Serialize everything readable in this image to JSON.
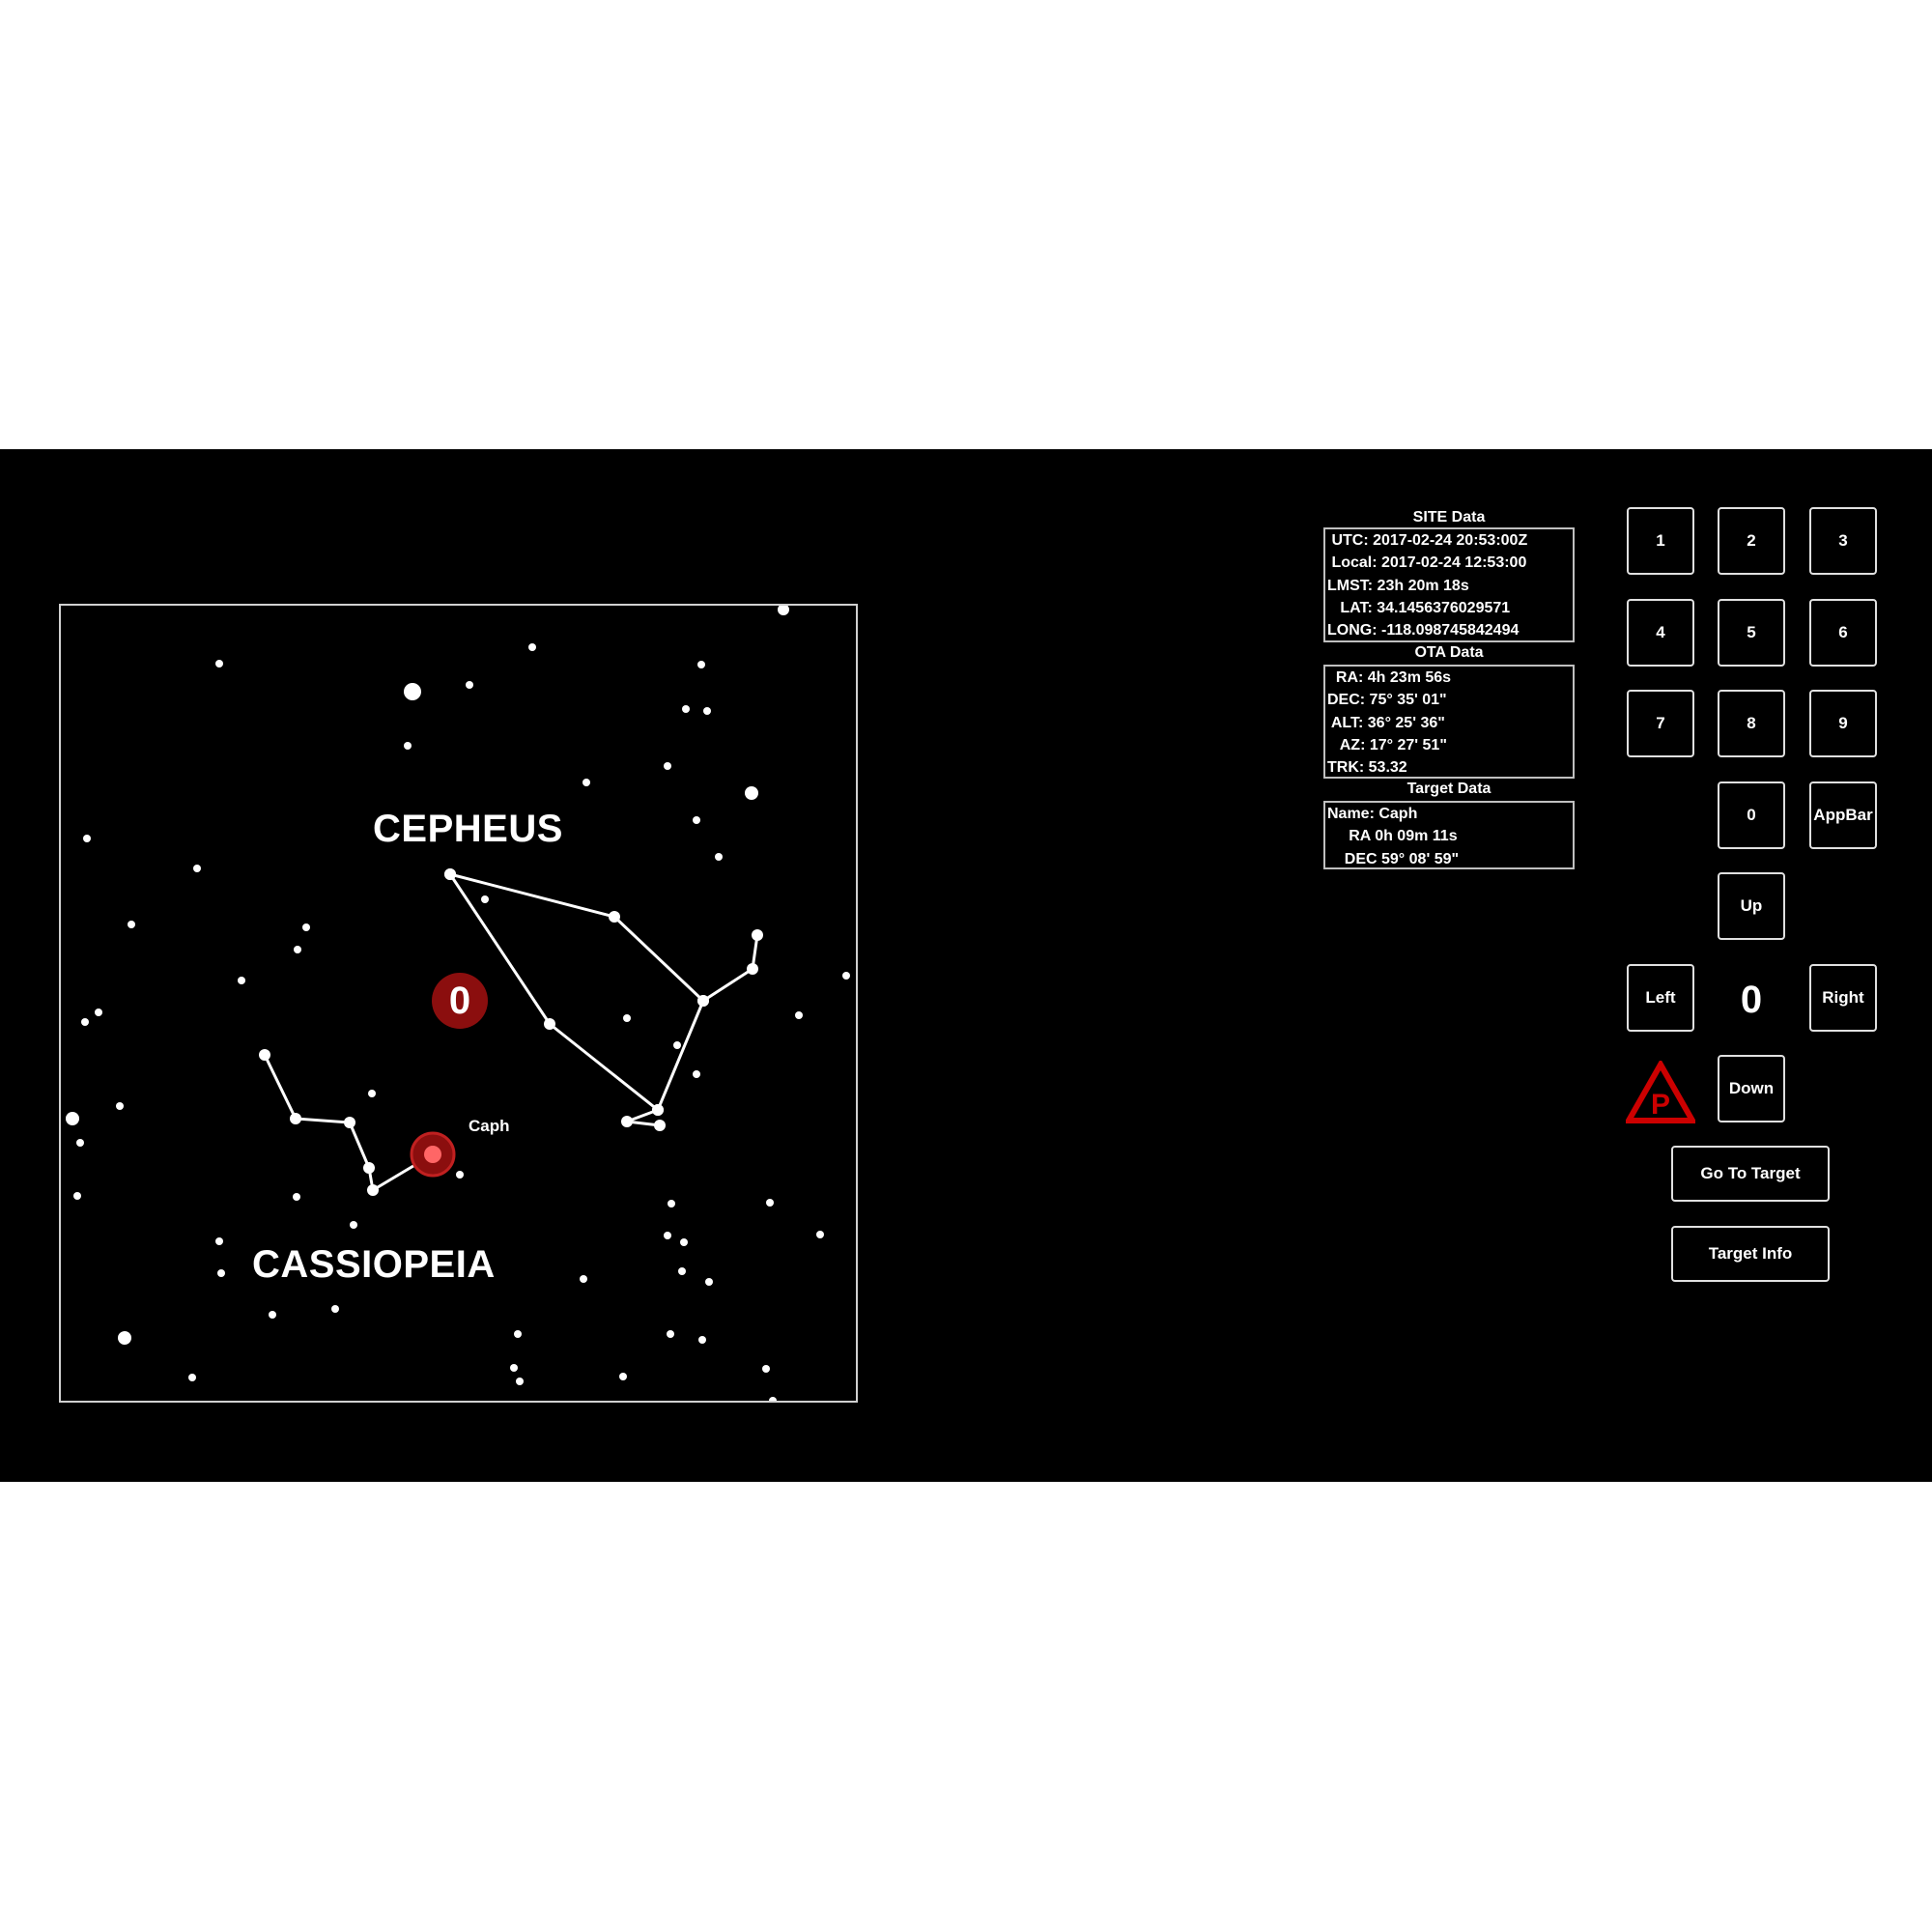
{
  "sky_map": {
    "constellations": [
      "CEPHEUS",
      "CASSIOPEIA"
    ],
    "target_label": "Caph",
    "object_count": "0"
  },
  "site_data": {
    "title": "SITE Data",
    "lines": [
      " UTC: 2017-02-24 20:53:00Z",
      " Local: 2017-02-24 12:53:00",
      "LMST: 23h 20m 18s",
      "   LAT: 34.1456376029571",
      "LONG: -118.098745842494"
    ]
  },
  "ota_data": {
    "title": "OTA Data",
    "lines": [
      "  RA: 4h 23m 56s",
      "DEC: 75° 35' 01\"",
      " ALT: 36° 25' 36\"",
      "   AZ: 17° 27' 51\"",
      "TRK: 53.32"
    ]
  },
  "target_data": {
    "title": "Target Data",
    "lines": [
      "Name: Caph",
      "     RA 0h 09m 11s",
      "    DEC 59° 08' 59\""
    ]
  },
  "keypad": {
    "keys": [
      "1",
      "2",
      "3",
      "4",
      "5",
      "6",
      "7",
      "8",
      "9",
      "0"
    ],
    "appbar": "AppBar",
    "up": "Up",
    "down": "Down",
    "left": "Left",
    "right": "Right",
    "rate_value": "0"
  },
  "actions": {
    "go_to_target": "Go To Target",
    "target_info": "Target Info"
  },
  "icons": {
    "park": "park-warning-icon"
  },
  "colors": {
    "background": "#000000",
    "accent_red": "#cc0000",
    "badge_red": "#8b0e0e",
    "line": "#ffffff"
  }
}
